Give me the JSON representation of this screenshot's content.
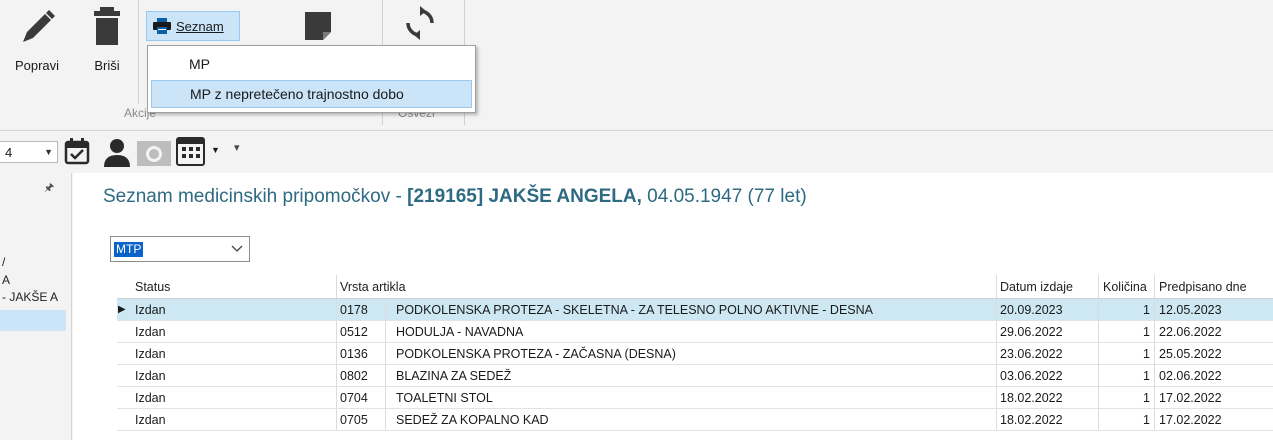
{
  "ribbon": {
    "popravi_label": "Popravi",
    "brisi_label": "Briši",
    "seznam_label": "Seznam",
    "akcije_group": "Akcije",
    "osvezi_group": "Osveži"
  },
  "menu": {
    "items": [
      {
        "label": "MP"
      },
      {
        "label": "MP z nepretečeno trajnostno dobo"
      }
    ]
  },
  "toolbar": {
    "combo_value": "4"
  },
  "leftpane": {
    "lines": [
      "/",
      "A",
      "- JAKŠE A"
    ]
  },
  "main": {
    "title_prefix": "Seznam medicinskih pripomočkov - ",
    "patient": "[219165] JAKŠE ANGELA,",
    "birth": " 04.05.1947 (77 let)",
    "filter_value": "MTP"
  },
  "grid": {
    "headers": {
      "status": "Status",
      "vrsta": "Vrsta artikla",
      "datum": "Datum izdaje",
      "kolicina": "Količina",
      "predpisano": "Predpisano dne"
    },
    "rows": [
      {
        "status": "Izdan",
        "code": "0178",
        "vrsta": "PODKOLENSKA PROTEZA - SKELETNA - ZA TELESNO POLNO AKTIVNE - DESNA",
        "datum": "20.09.2023",
        "kolicina": "1",
        "predpisano": "12.05.2023"
      },
      {
        "status": "Izdan",
        "code": "0512",
        "vrsta": "HODULJA - NAVADNA",
        "datum": "29.06.2022",
        "kolicina": "1",
        "predpisano": "22.06.2022"
      },
      {
        "status": "Izdan",
        "code": "0136",
        "vrsta": "PODKOLENSKA PROTEZA - ZAČASNA (DESNA)",
        "datum": "23.06.2022",
        "kolicina": "1",
        "predpisano": "25.05.2022"
      },
      {
        "status": "Izdan",
        "code": "0802",
        "vrsta": "BLAZINA ZA SEDEŽ",
        "datum": "03.06.2022",
        "kolicina": "1",
        "predpisano": "02.06.2022"
      },
      {
        "status": "Izdan",
        "code": "0704",
        "vrsta": "TOALETNI STOL",
        "datum": "18.02.2022",
        "kolicina": "1",
        "predpisano": "17.02.2022"
      },
      {
        "status": "Izdan",
        "code": "0705",
        "vrsta": "SEDEŽ ZA KOPALNO KAD",
        "datum": "18.02.2022",
        "kolicina": "1",
        "predpisano": "17.02.2022"
      }
    ]
  },
  "colors": {
    "title": "#2e6a82",
    "selection": "#cce4f7",
    "selected_row": "#cde8f2"
  }
}
